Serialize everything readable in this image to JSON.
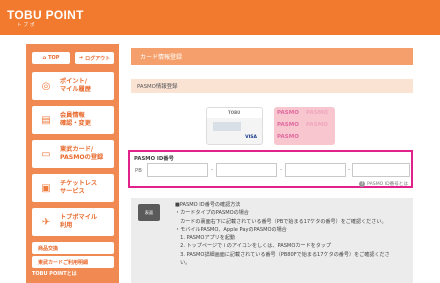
{
  "brand": {
    "logo": "TOBU POINT",
    "sub": "トブポ"
  },
  "colors": {
    "accent": "#f27a2e",
    "highlight": "#e0228a"
  },
  "sidebar": {
    "top_label": "TOP",
    "logout_label": "ログアウト",
    "items": [
      {
        "label1": "ポイント/",
        "label2": "マイル履歴",
        "icon": "coin-icon"
      },
      {
        "label1": "会員情報",
        "label2": "確認・変更",
        "icon": "member-icon"
      },
      {
        "label1": "東武カード/",
        "label2": "PASMOの登録",
        "icon": "card-icon"
      },
      {
        "label1": "チケットレス",
        "label2": "サービス",
        "icon": "train-icon"
      },
      {
        "label1": "トブポマイル",
        "label2": "利用",
        "icon": "mile-icon"
      }
    ],
    "small_items": [
      "商品交換",
      "東武カードご利用明細"
    ],
    "footer": "TOBU POINTとは"
  },
  "main": {
    "title": "カード情報登録",
    "section": "PASMO情報登録",
    "card_brand": "TOBU",
    "card_pasmo": "PASMO",
    "card_visa": "VISA",
    "id_label": "PASMO ID番号",
    "id_prefix": "PB",
    "help_label": "PASMO ID番号とは",
    "phone_label": "表面",
    "info_lines": [
      "■PASMO ID番号の確認方法",
      "・カードタイプのPASMOの場合",
      "　カードの裏面右下に記載されている番号（PBで始まる17ケタの番号）をご確認ください。",
      "・モバイルPASMO、Apple PayのPASMOの場合",
      "　1. PASMOアプリを起動",
      "　2. トップページで i のアイコンをしくは、PASMOカードをタップ",
      "　3. PASMO詳細画面に記載されている番号（PB80Fで始まる17ケタの番号）をご確認くださ",
      "　い。"
    ]
  }
}
